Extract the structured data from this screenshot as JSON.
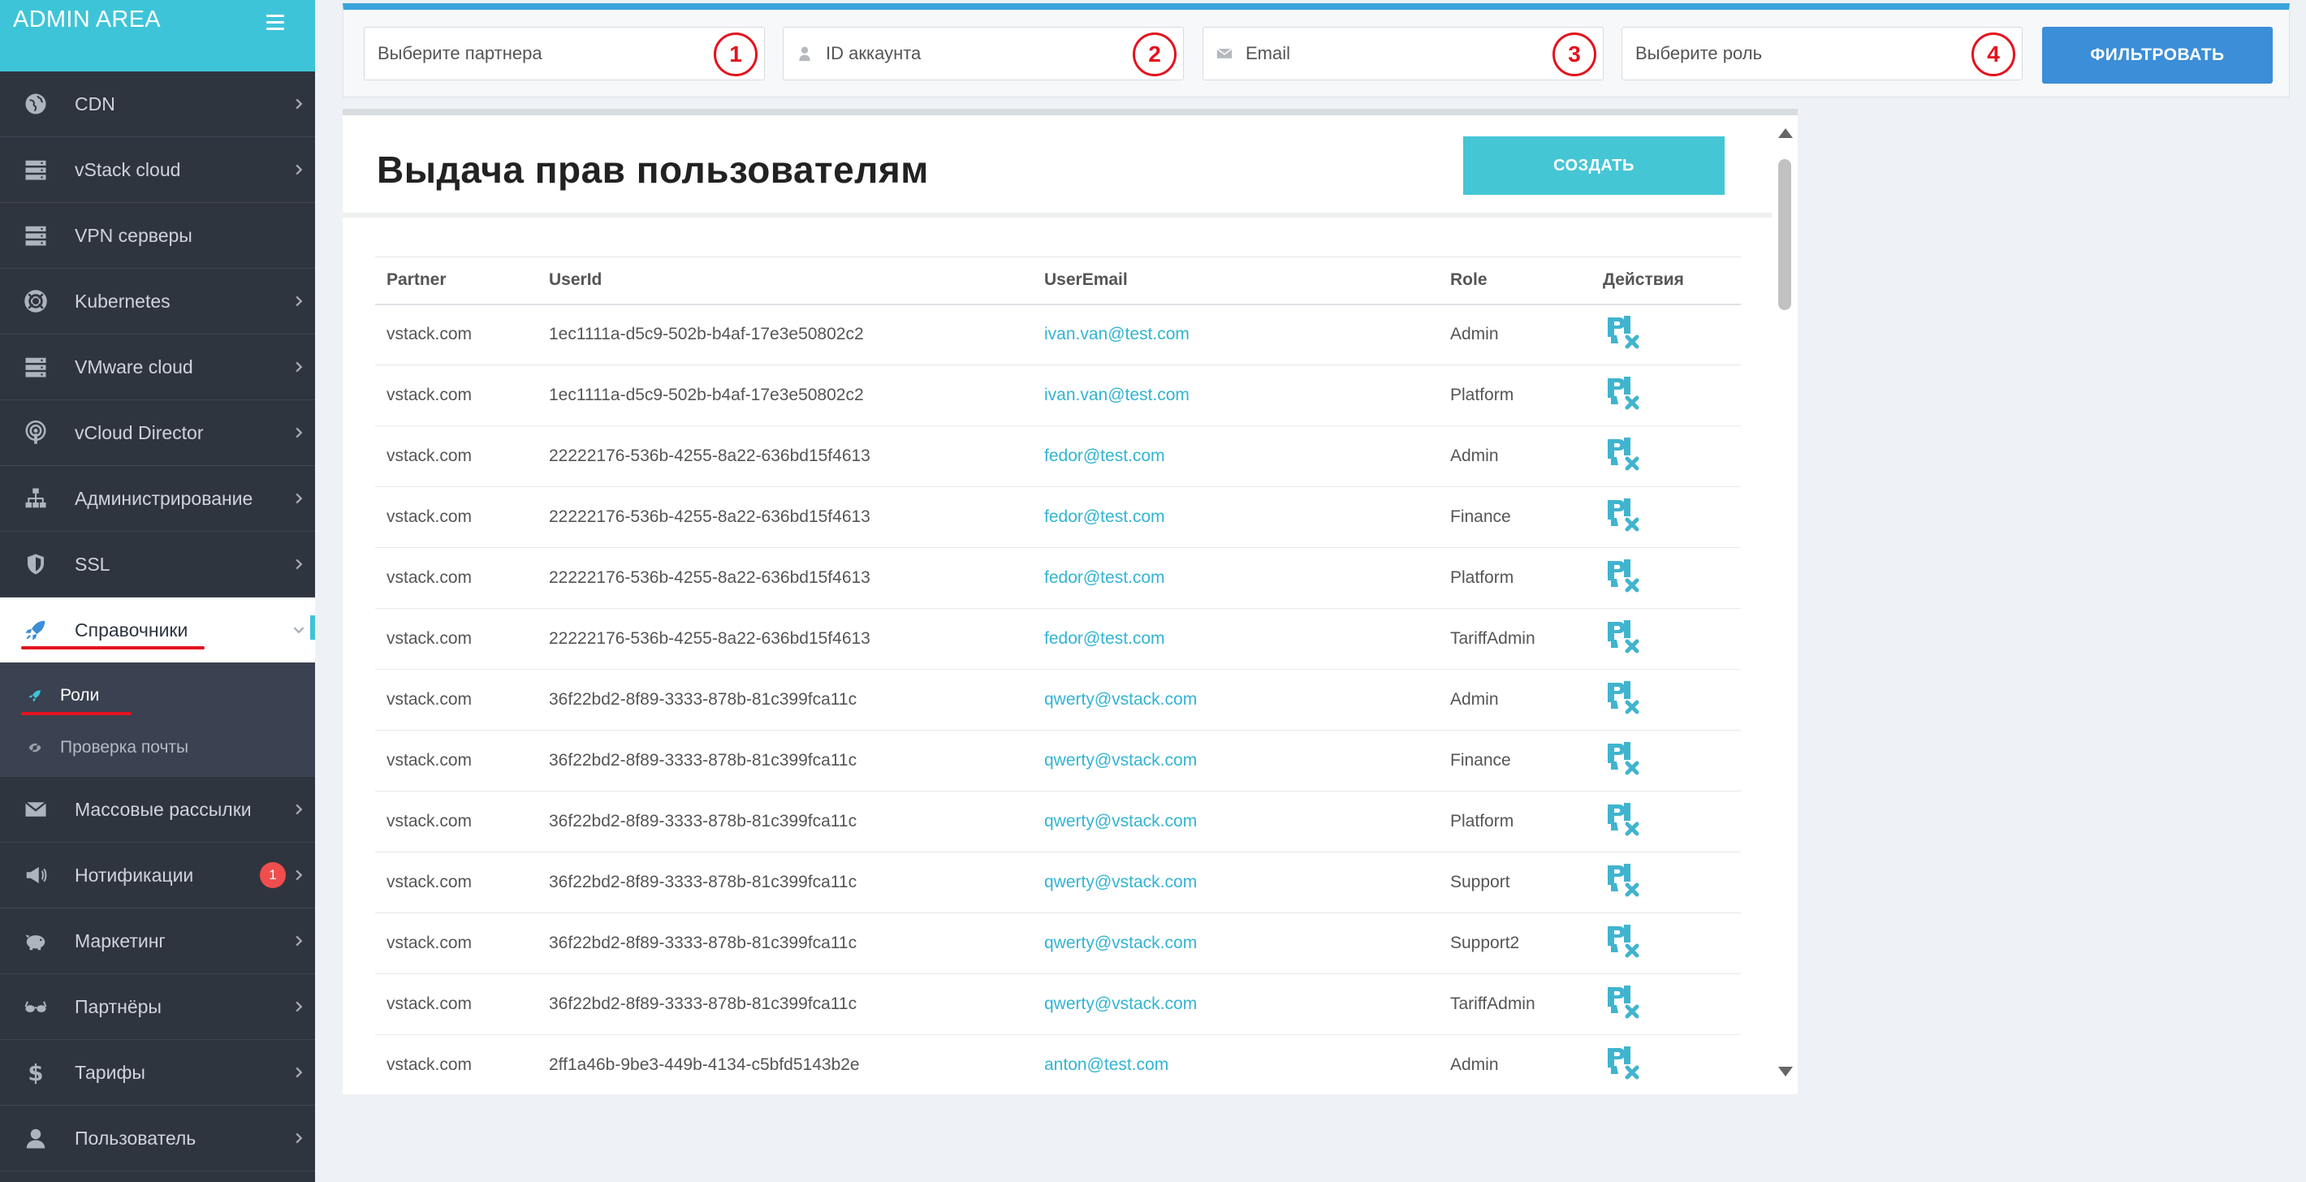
{
  "sidebar": {
    "title": "ADMIN AREA",
    "items": [
      {
        "label": "CDN",
        "icon": "globe-icon",
        "chevron": true
      },
      {
        "label": "vStack cloud",
        "icon": "server-icon",
        "chevron": true
      },
      {
        "label": "VPN серверы",
        "icon": "server-icon",
        "chevron": false
      },
      {
        "label": "Kubernetes",
        "icon": "lifebuoy-icon",
        "chevron": true
      },
      {
        "label": "VMware cloud",
        "icon": "server-icon",
        "chevron": true
      },
      {
        "label": "vCloud Director",
        "icon": "podcast-icon",
        "chevron": true
      },
      {
        "label": "Администрирование",
        "icon": "sitemap-icon",
        "chevron": true
      },
      {
        "label": "SSL",
        "icon": "shield-icon",
        "chevron": true
      },
      {
        "label": "Справочники",
        "icon": "rocket-icon",
        "chevron": true,
        "active": true
      }
    ],
    "subitems": [
      {
        "label": "Роли",
        "icon": "rocket-icon",
        "current": true
      },
      {
        "label": "Проверка почты",
        "icon": "eye-icon",
        "current": false
      }
    ],
    "items_after": [
      {
        "label": "Массовые рассылки",
        "icon": "envelope-icon"
      },
      {
        "label": "Нотификации",
        "icon": "bullhorn-icon",
        "badge": "1"
      },
      {
        "label": "Маркетинг",
        "icon": "piggy-bank-icon"
      },
      {
        "label": "Партнёры",
        "icon": "glasses-icon"
      },
      {
        "label": "Тарифы",
        "icon": "dollar-icon"
      },
      {
        "label": "Пользователь",
        "icon": "user-icon"
      }
    ]
  },
  "filters": {
    "partner_placeholder": "Выберите партнера",
    "account_placeholder": "ID аккаунта",
    "email_placeholder": "Email",
    "role_placeholder": "Выберите роль",
    "markers": [
      "1",
      "2",
      "3",
      "4"
    ],
    "filter_button": "ФИЛЬТРОВАТЬ"
  },
  "main": {
    "title": "Выдача прав пользователям",
    "create_button": "СОЗДАТЬ",
    "columns": [
      "Partner",
      "UserId",
      "UserEmail",
      "Role",
      "Действия"
    ],
    "rows": [
      [
        "vstack.com",
        "1ec1111a-d5c9-502b-b4af-17e3e50802c2",
        "ivan.van@test.com",
        "Admin"
      ],
      [
        "vstack.com",
        "1ec1111a-d5c9-502b-b4af-17e3e50802c2",
        "ivan.van@test.com",
        "Platform"
      ],
      [
        "vstack.com",
        "22222176-536b-4255-8a22-636bd15f4613",
        "fedor@test.com",
        "Admin"
      ],
      [
        "vstack.com",
        "22222176-536b-4255-8a22-636bd15f4613",
        "fedor@test.com",
        "Finance"
      ],
      [
        "vstack.com",
        "22222176-536b-4255-8a22-636bd15f4613",
        "fedor@test.com",
        "Platform"
      ],
      [
        "vstack.com",
        "22222176-536b-4255-8a22-636bd15f4613",
        "fedor@test.com",
        "TariffAdmin"
      ],
      [
        "vstack.com",
        "36f22bd2-8f89-3333-878b-81c399fca11c",
        "qwerty@vstack.com",
        "Admin"
      ],
      [
        "vstack.com",
        "36f22bd2-8f89-3333-878b-81c399fca11c",
        "qwerty@vstack.com",
        "Finance"
      ],
      [
        "vstack.com",
        "36f22bd2-8f89-3333-878b-81c399fca11c",
        "qwerty@vstack.com",
        "Platform"
      ],
      [
        "vstack.com",
        "36f22bd2-8f89-3333-878b-81c399fca11c",
        "qwerty@vstack.com",
        "Support"
      ],
      [
        "vstack.com",
        "36f22bd2-8f89-3333-878b-81c399fca11c",
        "qwerty@vstack.com",
        "Support2"
      ],
      [
        "vstack.com",
        "36f22bd2-8f89-3333-878b-81c399fca11c",
        "qwerty@vstack.com",
        "TariffAdmin"
      ],
      [
        "vstack.com",
        "2ff1a46b-9be3-449b-4134-c5bfd5143b2e",
        "anton@test.com",
        "Admin"
      ]
    ],
    "row_action_icon": "delete-user-icon"
  },
  "colors": {
    "sidebar_bg": "#2f353f",
    "accent_cyan": "#3ec4d8",
    "filter_blue": "#3b8ed7",
    "annotation_red": "#e3121e",
    "badge_red": "#f04e4e"
  }
}
